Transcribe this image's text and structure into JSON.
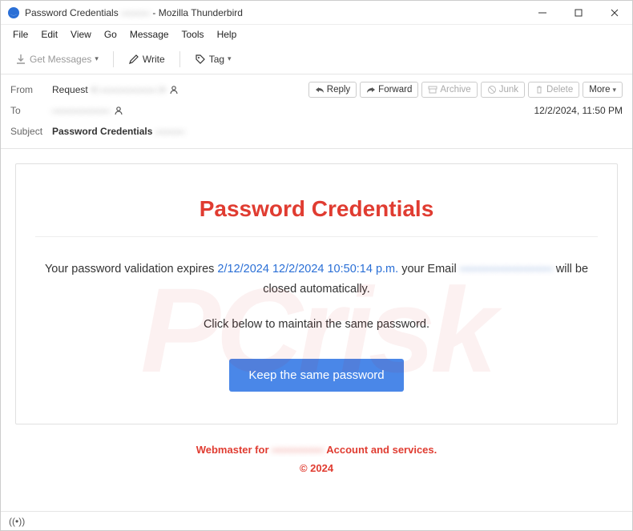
{
  "window": {
    "title_prefix": "Password Credentials",
    "title_redacted": "———",
    "title_suffix": " - Mozilla Thunderbird"
  },
  "menubar": [
    "File",
    "Edit",
    "View",
    "Go",
    "Message",
    "Tools",
    "Help"
  ],
  "toolbar": {
    "get_messages": "Get Messages",
    "write": "Write",
    "tag": "Tag"
  },
  "actions": {
    "reply": "Reply",
    "forward": "Forward",
    "archive": "Archive",
    "junk": "Junk",
    "delete": "Delete",
    "more": "More"
  },
  "header": {
    "from_label": "From",
    "from_name": "Request",
    "from_redacted": "< —————— >",
    "to_label": "To",
    "to_redacted": "——————",
    "subject_label": "Subject",
    "subject_prefix": "Password Credentials",
    "subject_redacted": "———",
    "datetime": "12/2/2024, 11:50 PM"
  },
  "email": {
    "title": "Password Credentials",
    "line1_a": "Your password validation expires ",
    "line1_date": "2/12/2024 12/2/2024 10:50:14 p.m.",
    "line1_b": " your Email ",
    "line1_email_redacted": "————————",
    "line1_c": " will be closed automatically.",
    "line2": "Click below to maintain the same password.",
    "cta": "Keep the same password",
    "footer_a": "Webmaster for ",
    "footer_redacted": "—————",
    "footer_b": " Account and services.",
    "footer_c": "© 2024"
  },
  "statusbar": {
    "text": "((•))"
  }
}
